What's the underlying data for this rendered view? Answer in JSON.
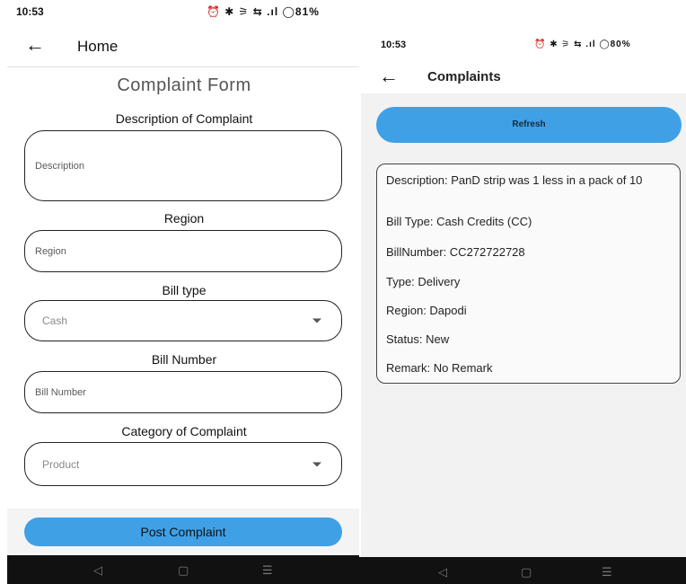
{
  "left": {
    "status": {
      "time": "10:53",
      "icons": "⏰ ✱ ⚞ ⇆ .ıl ◯81%"
    },
    "appbar": {
      "back_icon": "arrow-left-icon",
      "title": "Home"
    },
    "form_title": "Complaint Form",
    "labels": {
      "description": "Description of Complaint",
      "region": "Region",
      "bill_type": "Bill type",
      "bill_number": "Bill Number",
      "category": "Category of Complaint"
    },
    "fields": {
      "description_placeholder": "Description",
      "region_placeholder": "Region",
      "bill_type_value": "Cash",
      "bill_number_placeholder": "Bill Number",
      "category_value": "Product"
    },
    "post_button": "Post Complaint",
    "nav": {
      "back": "◁",
      "home": "▢",
      "recents": "☰"
    }
  },
  "right": {
    "status": {
      "time": "10:53",
      "icons": "⏰ ✱ ⚞ ⇆ .ıl ◯80%"
    },
    "appbar": {
      "back_icon": "arrow-left-icon",
      "title": "Complaints"
    },
    "refresh_button": "Refresh",
    "complaint": {
      "description": "Description: PanD strip was 1 less in a pack of 10",
      "bill_type": "Bill Type: Cash Credits (CC)",
      "bill_number": "BillNumber: CC272722728",
      "type": "Type: Delivery",
      "region": "Region: Dapodi",
      "status": "Status: New",
      "remark": "Remark: No Remark"
    },
    "nav": {
      "back": "◁",
      "home": "▢",
      "recents": "☰"
    }
  },
  "colors": {
    "accent": "#3fa0e6",
    "nav_bar": "#111111",
    "content_bg": "#f2f2f2"
  }
}
